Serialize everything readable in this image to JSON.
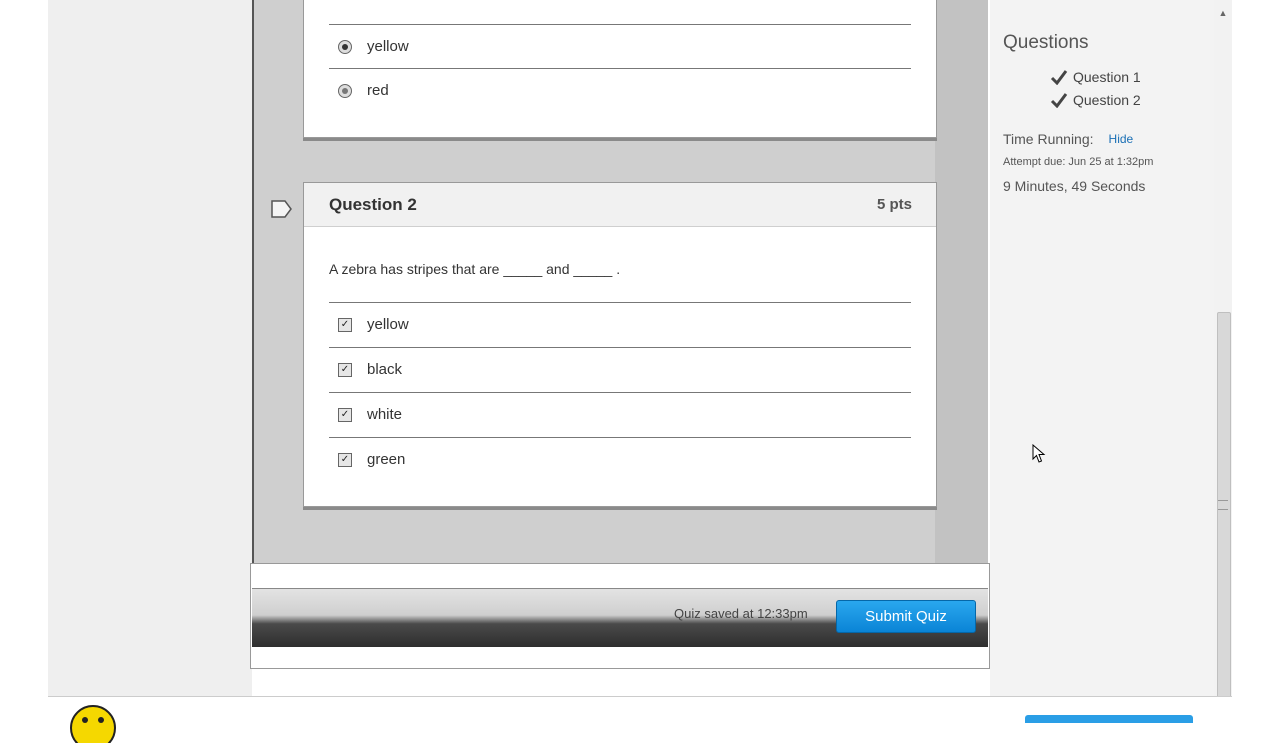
{
  "question1": {
    "answers": [
      {
        "label": "yellow",
        "type": "radio",
        "selected": true
      },
      {
        "label": "red",
        "type": "radio",
        "selected": false
      }
    ]
  },
  "question2": {
    "title": "Question 2",
    "points": "5 pts",
    "text": "A zebra has stripes that are _____ and _____ .",
    "answers": [
      {
        "label": "yellow",
        "type": "checkbox",
        "checked": true
      },
      {
        "label": "black",
        "type": "checkbox",
        "checked": true
      },
      {
        "label": "white",
        "type": "checkbox",
        "checked": true
      },
      {
        "label": "green",
        "type": "checkbox",
        "checked": true
      }
    ]
  },
  "footer": {
    "saved_text": "Quiz saved at 12:33pm",
    "submit_label": "Submit Quiz"
  },
  "sidebar": {
    "title": "Questions",
    "questions": [
      {
        "label": "Question 1",
        "answered": true
      },
      {
        "label": "Question 2",
        "answered": true
      }
    ],
    "time_label": "Time Running:",
    "hide_label": "Hide",
    "attempt_due": "Attempt due: Jun 25 at 1:32pm",
    "elapsed": "9 Minutes, 49 Seconds"
  },
  "colors": {
    "submit_button": "#0a84d6",
    "hide_link": "#1a6fb5"
  }
}
